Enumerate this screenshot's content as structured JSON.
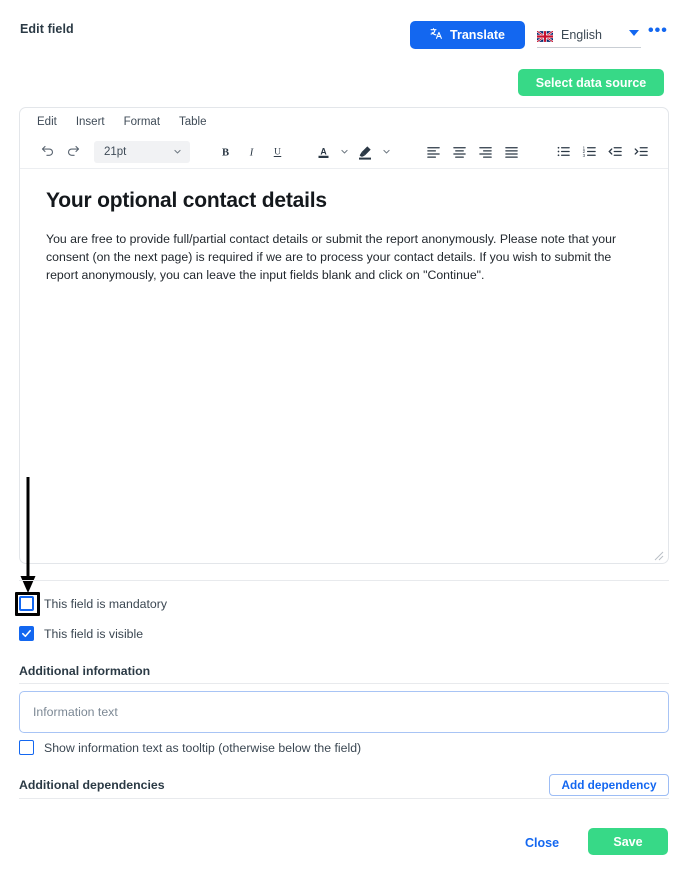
{
  "header": {
    "title": "Edit field",
    "translate_label": "Translate",
    "translate_icon": "translate-icon",
    "language": "English",
    "flag_icon": "uk-flag-icon",
    "more_icon": "ellipsis-icon",
    "more_label": "•••",
    "data_source_label": "Select data source"
  },
  "editor": {
    "menu": [
      "Edit",
      "Insert",
      "Format",
      "Table"
    ],
    "font_size": "21pt",
    "toolbar_icons": [
      "undo-icon",
      "redo-icon",
      "bold-icon",
      "italic-icon",
      "underline-icon",
      "text-color-icon",
      "highlight-color-icon",
      "align-left-icon",
      "align-center-icon",
      "align-right-icon",
      "align-justify-icon",
      "bullet-list-icon",
      "numbered-list-icon",
      "outdent-icon",
      "indent-icon",
      "toolbar-more-icon"
    ],
    "bold_label": "B",
    "italic_label": "I",
    "underline_label": "U",
    "text_color_label": "A",
    "more_label": "•••",
    "heading": "Your optional contact details",
    "paragraph": "You are free to provide full/partial contact details or submit the report anonymously. Please note that your consent (on the next page) is required if we are to process your contact details. If you wish to submit the report anonymously, you can leave the input fields blank and click on \"Continue\"."
  },
  "options": {
    "mandatory_label": "This field is mandatory",
    "mandatory_checked": false,
    "visible_label": "This field is visible",
    "visible_checked": true
  },
  "additional_information": {
    "section_label": "Additional information",
    "input_value": "",
    "input_placeholder": "Information text",
    "tooltip_label": "Show information text as tooltip (otherwise below the field)",
    "tooltip_checked": false
  },
  "dependencies": {
    "section_label": "Additional dependencies",
    "add_label": "Add dependency"
  },
  "footer": {
    "close_label": "Close",
    "save_label": "Save"
  },
  "annotation": {
    "arrow_icon": "down-arrow-annotation",
    "highlight_icon": "highlight-rectangle-annotation"
  },
  "colors": {
    "primary_blue": "#1367f0",
    "green": "#37d987",
    "text": "#2e3a44",
    "border": "#e3e6ea"
  }
}
